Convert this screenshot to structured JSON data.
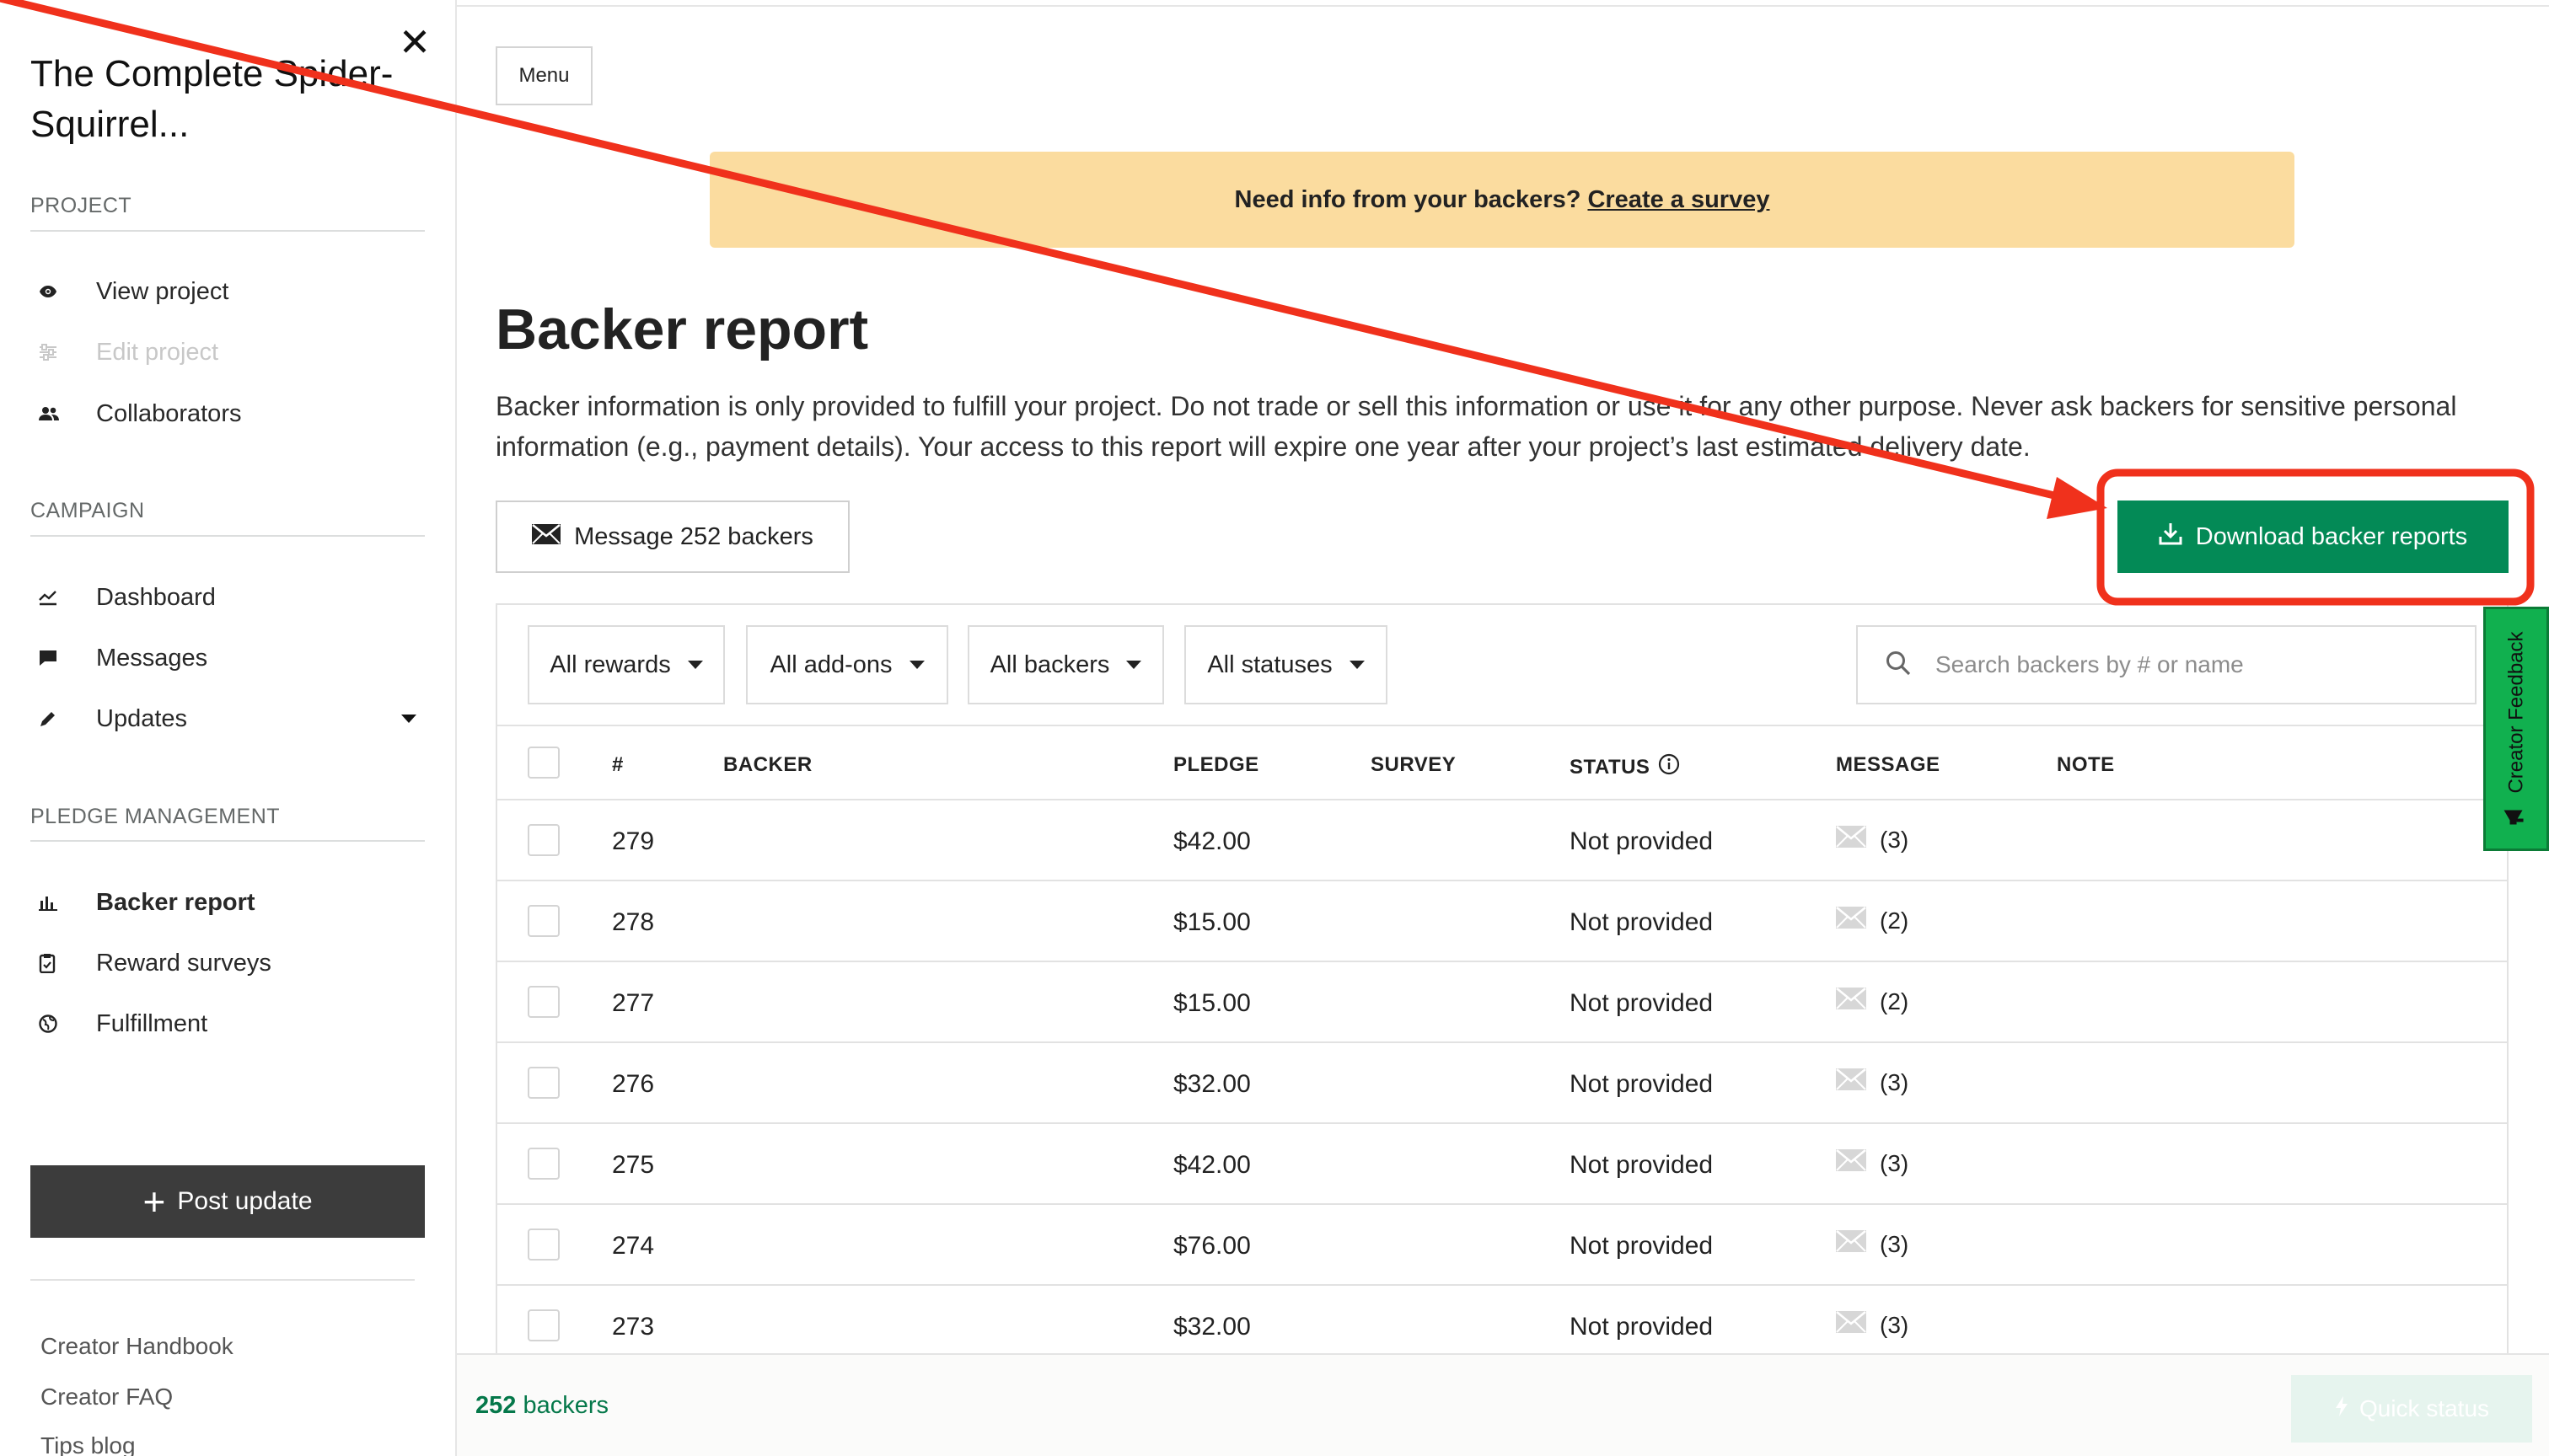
{
  "sidebar": {
    "project_title": "The Complete Spider-Squirrel...",
    "sections": [
      {
        "label": "PROJECT",
        "items": [
          {
            "label": "View project",
            "icon": "eye-icon",
            "state": "normal"
          },
          {
            "label": "Edit project",
            "icon": "sliders-icon",
            "state": "disabled"
          },
          {
            "label": "Collaborators",
            "icon": "people-icon",
            "state": "normal"
          }
        ]
      },
      {
        "label": "CAMPAIGN",
        "items": [
          {
            "label": "Dashboard",
            "icon": "chart-line-icon",
            "state": "normal"
          },
          {
            "label": "Messages",
            "icon": "chat-bubble-icon",
            "state": "normal"
          },
          {
            "label": "Updates",
            "icon": "pencil-icon",
            "state": "normal",
            "has_dropdown": true
          }
        ]
      },
      {
        "label": "PLEDGE MANAGEMENT",
        "items": [
          {
            "label": "Backer report",
            "icon": "bar-chart-icon",
            "state": "active"
          },
          {
            "label": "Reward surveys",
            "icon": "clipboard-icon",
            "state": "normal"
          },
          {
            "label": "Fulfillment",
            "icon": "globe-icon",
            "state": "normal"
          }
        ]
      }
    ],
    "post_update_label": "Post update",
    "footer_links": [
      "Creator Handbook",
      "Creator FAQ",
      "Tips blog"
    ]
  },
  "header": {
    "menu_label": "Menu"
  },
  "banner": {
    "text": "Need info from your backers?",
    "link": "Create a survey",
    "color": "#fbdc9f"
  },
  "main": {
    "title": "Backer report",
    "description": "Backer information is only provided to fulfill your project. Do not trade or sell this information or use it for any other purpose. Never ask backers for sensitive personal information (e.g., payment details). Your access to this report will expire one year after your project’s last estimated delivery date.",
    "message_button": "Message 252 backers",
    "download_button": "Download backer reports",
    "accent_color": "#038a56"
  },
  "filters": {
    "rewards": "All rewards",
    "addons": "All add-ons",
    "backers": "All backers",
    "statuses": "All statuses",
    "search_placeholder": "Search backers by # or name"
  },
  "table": {
    "columns": [
      "#",
      "BACKER",
      "PLEDGE",
      "SURVEY",
      "STATUS",
      "MESSAGE",
      "NOTE"
    ],
    "rows": [
      {
        "num": "279",
        "backer": "",
        "pledge": "$42.00",
        "survey": "",
        "status": "Not provided",
        "messages": "(3)",
        "note": ""
      },
      {
        "num": "278",
        "backer": "",
        "pledge": "$15.00",
        "survey": "",
        "status": "Not provided",
        "messages": "(2)",
        "note": ""
      },
      {
        "num": "277",
        "backer": "",
        "pledge": "$15.00",
        "survey": "",
        "status": "Not provided",
        "messages": "(2)",
        "note": ""
      },
      {
        "num": "276",
        "backer": "",
        "pledge": "$32.00",
        "survey": "",
        "status": "Not provided",
        "messages": "(3)",
        "note": ""
      },
      {
        "num": "275",
        "backer": "",
        "pledge": "$42.00",
        "survey": "",
        "status": "Not provided",
        "messages": "(3)",
        "note": ""
      },
      {
        "num": "274",
        "backer": "",
        "pledge": "$76.00",
        "survey": "",
        "status": "Not provided",
        "messages": "(3)",
        "note": ""
      },
      {
        "num": "273",
        "backer": "",
        "pledge": "$32.00",
        "survey": "",
        "status": "Not provided",
        "messages": "(3)",
        "note": ""
      }
    ]
  },
  "footer": {
    "backers_count": "252",
    "backers_label": "backers",
    "quick_status_label": "Quick status"
  },
  "feedback_tab": {
    "label": "Creator Feedback"
  },
  "annotation": {
    "color": "#f0311c"
  }
}
